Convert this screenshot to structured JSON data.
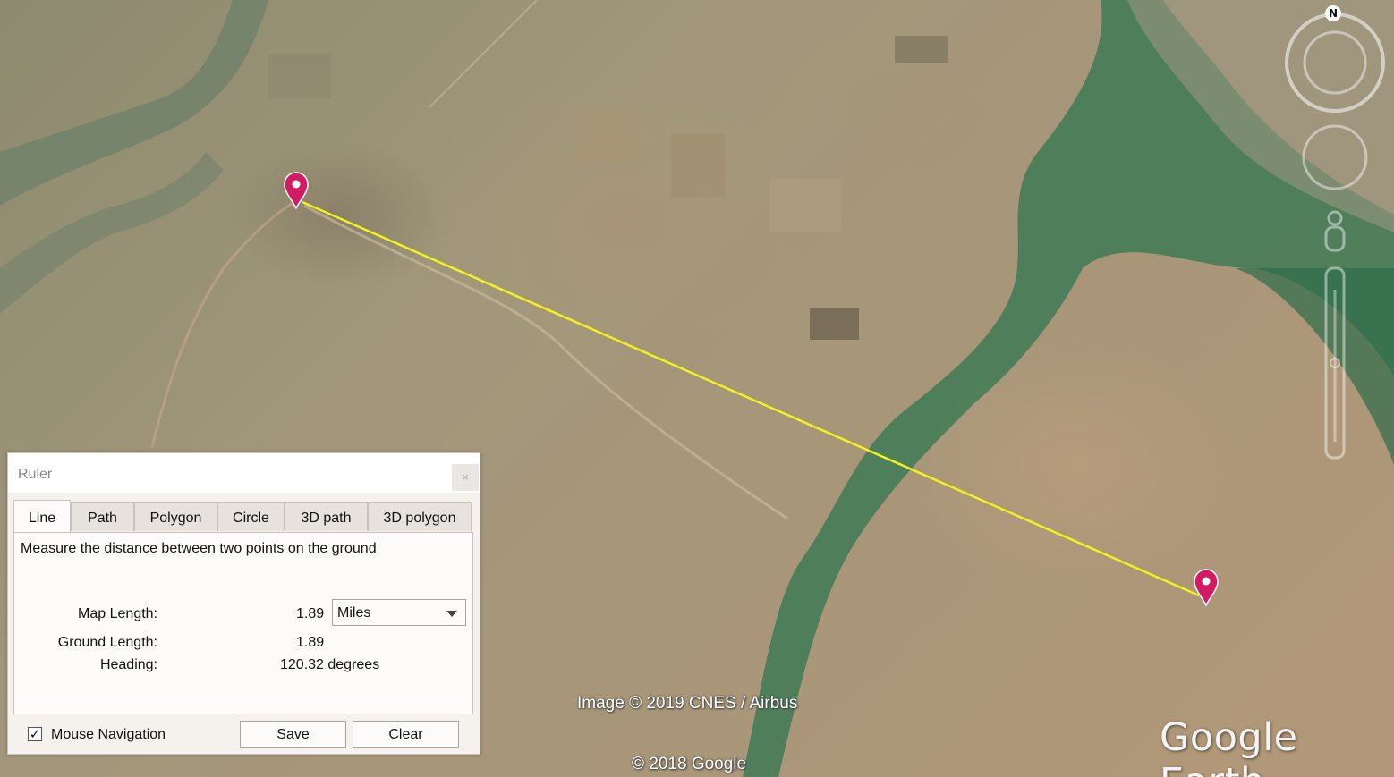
{
  "map": {
    "imagery_credit": "Image © 2019 CNES / Airbus",
    "copyright": "© 2018 Google",
    "brand": "Google Earth",
    "compass_label": "N",
    "measure_line_color": "#f2f21e",
    "pin_color": "#d21b62"
  },
  "ruler": {
    "title": "Ruler",
    "close_label": "×",
    "tabs": [
      {
        "label": "Line",
        "active": true
      },
      {
        "label": "Path"
      },
      {
        "label": "Polygon"
      },
      {
        "label": "Circle"
      },
      {
        "label": "3D path"
      },
      {
        "label": "3D polygon"
      }
    ],
    "description": "Measure the distance between two points on the ground",
    "map_length_label": "Map Length:",
    "map_length_value": "1.89",
    "unit_selected": "Miles",
    "ground_length_label": "Ground Length:",
    "ground_length_value": "1.89",
    "heading_label": "Heading:",
    "heading_value": "120.32 degrees",
    "mouse_navigation_label": "Mouse Navigation",
    "mouse_navigation_checked": true,
    "save_label": "Save",
    "clear_label": "Clear"
  }
}
